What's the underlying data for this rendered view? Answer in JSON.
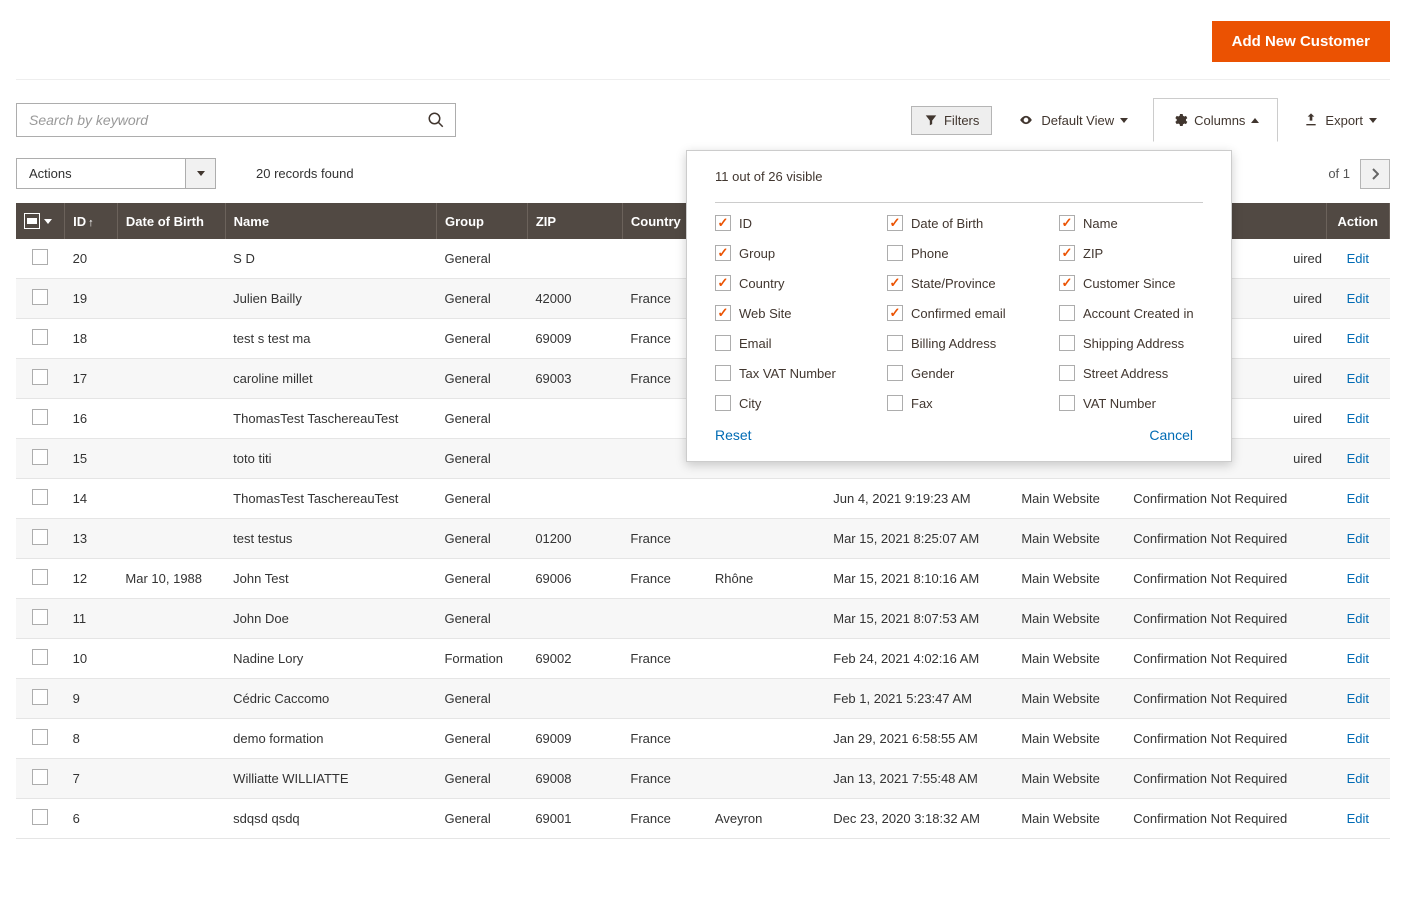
{
  "header": {
    "add_button": "Add New Customer"
  },
  "search": {
    "placeholder": "Search by keyword"
  },
  "toolbar": {
    "filters": "Filters",
    "default_view": "Default View",
    "columns": "Columns",
    "export": "Export"
  },
  "actionsRow": {
    "actions_label": "Actions",
    "records_found": "20 records found",
    "page_of": "of 1"
  },
  "columns_panel": {
    "summary": "11 out of 26 visible",
    "reset": "Reset",
    "cancel": "Cancel",
    "cols": [
      [
        {
          "label": "ID",
          "checked": true
        },
        {
          "label": "Group",
          "checked": true
        },
        {
          "label": "Country",
          "checked": true
        },
        {
          "label": "Web Site",
          "checked": true
        },
        {
          "label": "Email",
          "checked": false
        },
        {
          "label": "Tax VAT Number",
          "checked": false
        },
        {
          "label": "City",
          "checked": false
        }
      ],
      [
        {
          "label": "Date of Birth",
          "checked": true
        },
        {
          "label": "Phone",
          "checked": false
        },
        {
          "label": "State/Province",
          "checked": true
        },
        {
          "label": "Confirmed email",
          "checked": true
        },
        {
          "label": "Billing Address",
          "checked": false
        },
        {
          "label": "Gender",
          "checked": false
        },
        {
          "label": "Fax",
          "checked": false
        }
      ],
      [
        {
          "label": "Name",
          "checked": true
        },
        {
          "label": "ZIP",
          "checked": true
        },
        {
          "label": "Customer Since",
          "checked": true
        },
        {
          "label": "Account Created in",
          "checked": false
        },
        {
          "label": "Shipping Address",
          "checked": false
        },
        {
          "label": "Street Address",
          "checked": false
        },
        {
          "label": "VAT Number",
          "checked": false
        }
      ]
    ]
  },
  "table": {
    "headers": [
      "ID",
      "Date of Birth",
      "Name",
      "Group",
      "ZIP",
      "Country",
      "",
      "",
      "",
      "",
      "Action"
    ],
    "header_labels": {
      "id": "ID",
      "dob": "Date of Birth",
      "name": "Name",
      "group": "Group",
      "zip": "ZIP",
      "country": "Country",
      "action": "Action"
    },
    "hidden_headers": {
      "state": "State/Province",
      "since": "Customer Since",
      "website": "Web Site",
      "confirmed": "Confirmed email"
    },
    "rows": [
      {
        "id": "20",
        "dob": "",
        "name": "S D",
        "group": "General",
        "zip": "",
        "country": "",
        "state": "",
        "since": "",
        "website": "",
        "confirmed": "",
        "edit": "Edit",
        "confirmed_tail": "uired"
      },
      {
        "id": "19",
        "dob": "",
        "name": "Julien Bailly",
        "group": "General",
        "zip": "42000",
        "country": "France",
        "state": "",
        "since": "",
        "website": "",
        "confirmed": "",
        "edit": "Edit",
        "confirmed_tail": "uired"
      },
      {
        "id": "18",
        "dob": "",
        "name": "test s test ma",
        "group": "General",
        "zip": "69009",
        "country": "France",
        "state": "",
        "since": "",
        "website": "",
        "confirmed": "",
        "edit": "Edit",
        "confirmed_tail": "uired"
      },
      {
        "id": "17",
        "dob": "",
        "name": "caroline millet",
        "group": "General",
        "zip": "69003",
        "country": "France",
        "state": "",
        "since": "",
        "website": "",
        "confirmed": "",
        "edit": "Edit",
        "confirmed_tail": "uired"
      },
      {
        "id": "16",
        "dob": "",
        "name": "ThomasTest TaschereauTest",
        "group": "General",
        "zip": "",
        "country": "",
        "state": "",
        "since": "",
        "website": "",
        "confirmed": "",
        "edit": "Edit",
        "confirmed_tail": "uired"
      },
      {
        "id": "15",
        "dob": "",
        "name": "toto titi",
        "group": "General",
        "zip": "",
        "country": "",
        "state": "",
        "since": "",
        "website": "",
        "confirmed": "",
        "edit": "Edit",
        "confirmed_tail": "uired"
      },
      {
        "id": "14",
        "dob": "",
        "name": "ThomasTest TaschereauTest",
        "group": "General",
        "zip": "",
        "country": "",
        "state": "",
        "since": "Jun 4, 2021 9:19:23 AM",
        "website": "Main Website",
        "confirmed": "Confirmation Not Required",
        "edit": "Edit"
      },
      {
        "id": "13",
        "dob": "",
        "name": "test testus",
        "group": "General",
        "zip": "01200",
        "country": "France",
        "state": "",
        "since": "Mar 15, 2021 8:25:07 AM",
        "website": "Main Website",
        "confirmed": "Confirmation Not Required",
        "edit": "Edit"
      },
      {
        "id": "12",
        "dob": "Mar 10, 1988",
        "name": "John Test",
        "group": "General",
        "zip": "69006",
        "country": "France",
        "state": "Rhône",
        "since": "Mar 15, 2021 8:10:16 AM",
        "website": "Main Website",
        "confirmed": "Confirmation Not Required",
        "edit": "Edit"
      },
      {
        "id": "11",
        "dob": "",
        "name": "John Doe",
        "group": "General",
        "zip": "",
        "country": "",
        "state": "",
        "since": "Mar 15, 2021 8:07:53 AM",
        "website": "Main Website",
        "confirmed": "Confirmation Not Required",
        "edit": "Edit"
      },
      {
        "id": "10",
        "dob": "",
        "name": "Nadine Lory",
        "group": "Formation",
        "zip": "69002",
        "country": "France",
        "state": "",
        "since": "Feb 24, 2021 4:02:16 AM",
        "website": "Main Website",
        "confirmed": "Confirmation Not Required",
        "edit": "Edit"
      },
      {
        "id": "9",
        "dob": "",
        "name": "Cédric Caccomo",
        "group": "General",
        "zip": "",
        "country": "",
        "state": "",
        "since": "Feb 1, 2021 5:23:47 AM",
        "website": "Main Website",
        "confirmed": "Confirmation Not Required",
        "edit": "Edit"
      },
      {
        "id": "8",
        "dob": "",
        "name": "demo formation",
        "group": "General",
        "zip": "69009",
        "country": "France",
        "state": "",
        "since": "Jan 29, 2021 6:58:55 AM",
        "website": "Main Website",
        "confirmed": "Confirmation Not Required",
        "edit": "Edit"
      },
      {
        "id": "7",
        "dob": "",
        "name": "Williatte WILLIATTE",
        "group": "General",
        "zip": "69008",
        "country": "France",
        "state": "",
        "since": "Jan 13, 2021 7:55:48 AM",
        "website": "Main Website",
        "confirmed": "Confirmation Not Required",
        "edit": "Edit"
      },
      {
        "id": "6",
        "dob": "",
        "name": "sdqsd qsdq",
        "group": "General",
        "zip": "69001",
        "country": "France",
        "state": "Aveyron",
        "since": "Dec 23, 2020 3:18:32 AM",
        "website": "Main Website",
        "confirmed": "Confirmation Not Required",
        "edit": "Edit"
      }
    ]
  }
}
